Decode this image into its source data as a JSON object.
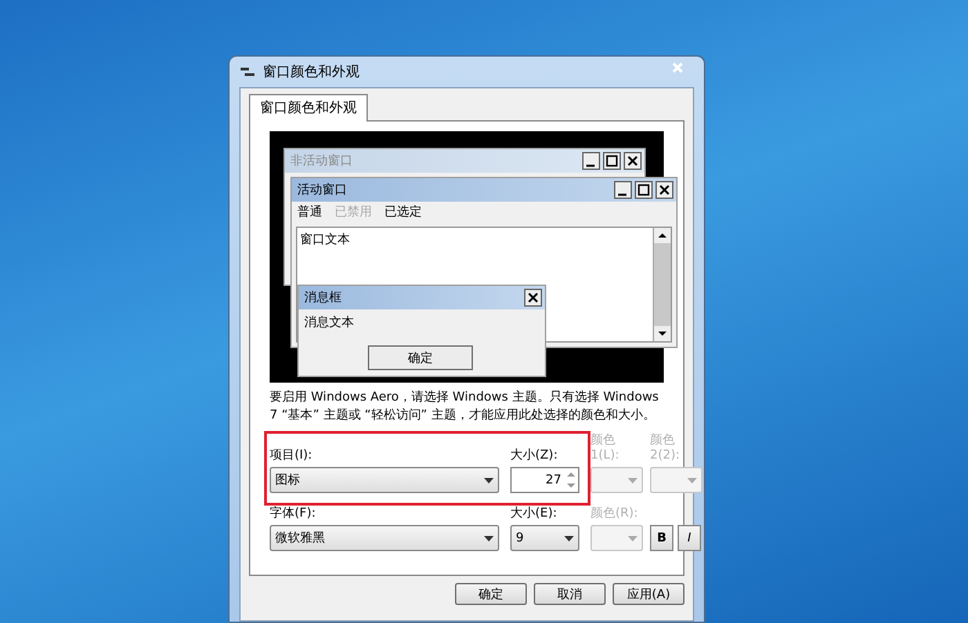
{
  "window": {
    "title": "窗口颜色和外观"
  },
  "tabs": [
    {
      "label": "窗口颜色和外观",
      "selected": true
    }
  ],
  "preview": {
    "inactive_window": {
      "title": "非活动窗口"
    },
    "active_window": {
      "title": "活动窗口",
      "menu": [
        {
          "label": "普通",
          "disabled": false
        },
        {
          "label": "已禁用",
          "disabled": true
        },
        {
          "label": "已选定",
          "disabled": false
        }
      ],
      "text": "窗口文本"
    },
    "message_box": {
      "title": "消息框",
      "text": "消息文本",
      "button": "确定"
    }
  },
  "description": "要启用 Windows Aero，请选择 Windows 主题。只有选择 Windows 7 “基本” 主题或 “轻松访问” 主题，才能应用此处选择的颜色和大小。",
  "item": {
    "label": "项目(I):",
    "value": "图标"
  },
  "size": {
    "label": "大小(Z):",
    "value": "27"
  },
  "color1": {
    "label": "颜色 1(L):",
    "disabled": true
  },
  "color2": {
    "label": "颜色 2(2):",
    "disabled": true
  },
  "font": {
    "label": "字体(F):",
    "value": "微软雅黑"
  },
  "font_size": {
    "label": "大小(E):",
    "value": "9"
  },
  "font_color": {
    "label": "颜色(R):",
    "disabled": true
  },
  "bold": {
    "label": "B"
  },
  "italic": {
    "label": "I"
  },
  "buttons": [
    "确定",
    "取消",
    "应用(A)"
  ]
}
